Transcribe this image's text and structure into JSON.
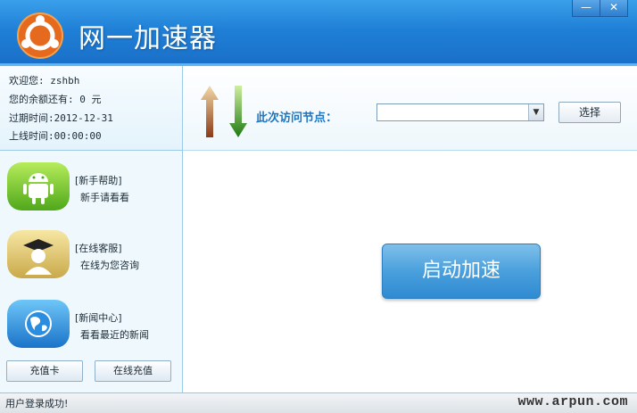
{
  "app": {
    "title": "网一加速器"
  },
  "window_controls": {
    "minimize": "—",
    "close": "✕"
  },
  "user_info": {
    "welcome": "欢迎您: zshbh",
    "balance": "您的余额还有: 0 元",
    "expire": "过期时间:2012-12-31",
    "online_time": "上线时间:00:00:00"
  },
  "menu": [
    {
      "title": "[新手帮助]",
      "desc": "新手请看看",
      "icon": "android-icon"
    },
    {
      "title": "[在线客服]",
      "desc": "在线为您咨询",
      "icon": "graduate-icon"
    },
    {
      "title": "[新闻中心]",
      "desc": "看看最近的新闻",
      "icon": "globe-icon"
    }
  ],
  "sidebar_buttons": {
    "recharge_card": "充值卡",
    "online_recharge": "在线充值"
  },
  "toolbar": {
    "node_label": "此次访问节点：",
    "node_value": "",
    "choose": "选择"
  },
  "main": {
    "accelerate": "启动加速"
  },
  "status": {
    "message": "用户登录成功!",
    "watermark": "www.arpun.com"
  },
  "colors": {
    "title_bar": "#1f7fd6",
    "accent": "#1b76c6",
    "accelerate_button": "#4aa0dd"
  }
}
